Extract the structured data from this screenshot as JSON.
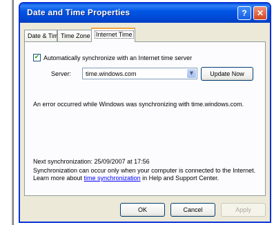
{
  "window": {
    "title": "Date and Time Properties",
    "help_glyph": "?",
    "close_glyph": "✕"
  },
  "tabs": [
    {
      "label": "Date & Time",
      "active": false
    },
    {
      "label": "Time Zone",
      "active": false
    },
    {
      "label": "Internet Time",
      "active": true
    }
  ],
  "internet_time": {
    "auto_sync_checked": true,
    "auto_sync_label": "Automatically synchronize with an Internet time server",
    "server_label": "Server:",
    "server_value": "time.windows.com",
    "update_button": "Update Now",
    "error_message": "An error occurred while Windows was synchronizing with time.windows.com.",
    "next_sync": "Next synchronization: 25/09/2007 at 17:56",
    "info_prefix": "Synchronization can occur only when your computer is connected to the Internet. Learn more about ",
    "info_link": "time synchronization",
    "info_suffix": " in Help and Support Center."
  },
  "footer": {
    "ok_label": "OK",
    "cancel_label": "Cancel",
    "apply_label": "Apply"
  },
  "colors": {
    "titlebar": "#0055e5",
    "dialog_bg": "#ece9d8",
    "active_tab_accent": "#f1a43a",
    "link": "#0000ff"
  }
}
